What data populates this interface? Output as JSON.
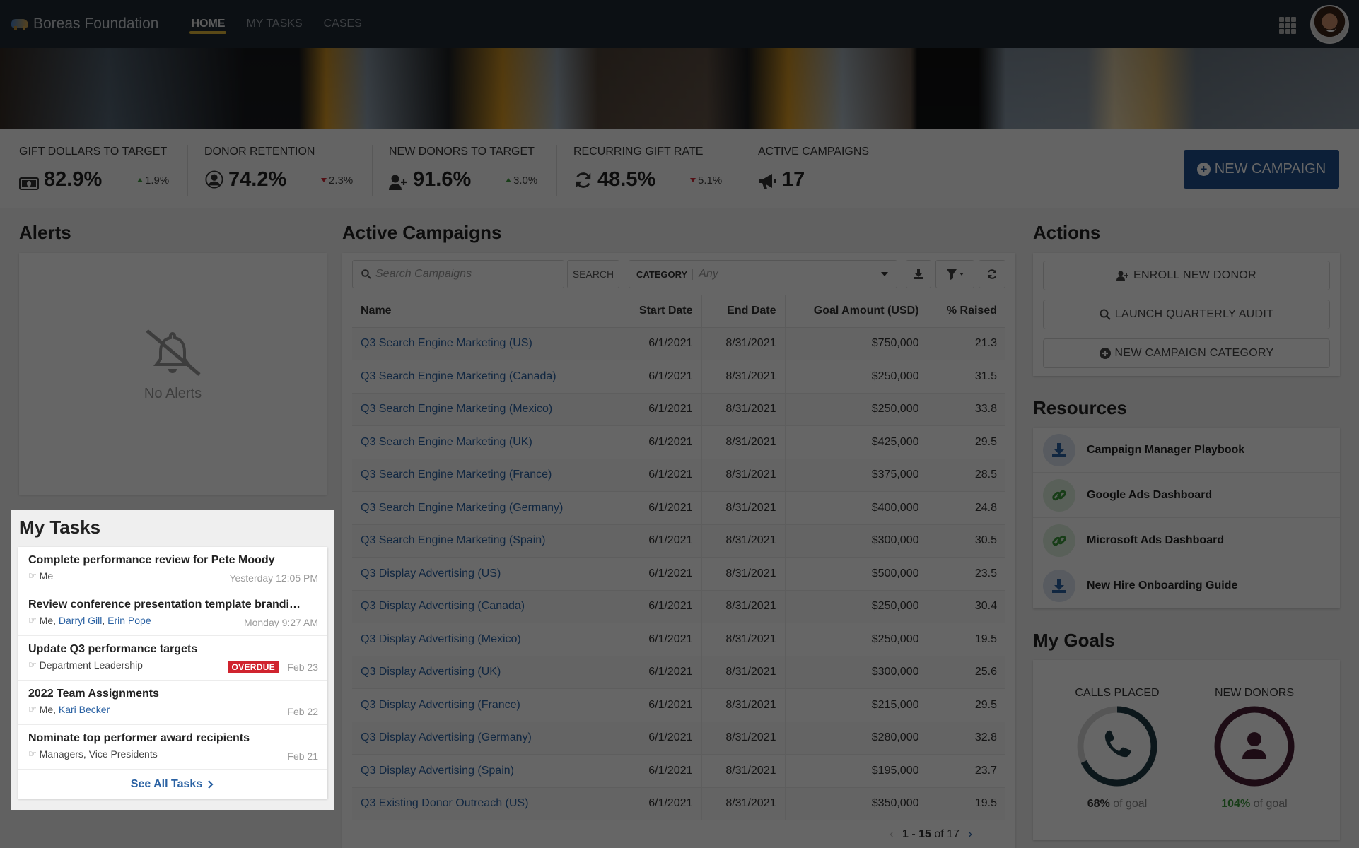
{
  "nav": {
    "brand": "Boreas Foundation",
    "tabs": [
      {
        "label": "HOME",
        "active": true
      },
      {
        "label": "MY TASKS",
        "active": false
      },
      {
        "label": "CASES",
        "active": false
      }
    ],
    "apps_icon": "grid-icon",
    "avatar": "user-avatar"
  },
  "kpis": [
    {
      "label": "GIFT DOLLARS TO TARGET",
      "icon": "money-icon",
      "value": "82.9%",
      "delta": "1.9%",
      "direction": "up"
    },
    {
      "label": "DONOR RETENTION",
      "icon": "user-circle-icon",
      "value": "74.2%",
      "delta": "2.3%",
      "direction": "down"
    },
    {
      "label": "NEW DONORS TO TARGET",
      "icon": "user-plus-icon",
      "value": "91.6%",
      "delta": "3.0%",
      "direction": "up"
    },
    {
      "label": "RECURRING GIFT RATE",
      "icon": "refresh-icon",
      "value": "48.5%",
      "delta": "5.1%",
      "direction": "down"
    },
    {
      "label": "ACTIVE CAMPAIGNS",
      "icon": "megaphone-icon",
      "value": "17"
    }
  ],
  "new_campaign_button": "NEW CAMPAIGN",
  "alerts": {
    "title": "Alerts",
    "empty_text": "No Alerts"
  },
  "campaigns": {
    "title": "Active Campaigns",
    "search_placeholder": "Search Campaigns",
    "search_button": "SEARCH",
    "category_label": "CATEGORY",
    "category_value": "Any",
    "columns": [
      "Name",
      "Start Date",
      "End Date",
      "Goal Amount (USD)",
      "% Raised"
    ],
    "rows": [
      [
        "Q3 Search Engine Marketing (US)",
        "6/1/2021",
        "8/31/2021",
        "$750,000",
        "21.3"
      ],
      [
        "Q3 Search Engine Marketing (Canada)",
        "6/1/2021",
        "8/31/2021",
        "$250,000",
        "31.5"
      ],
      [
        "Q3 Search Engine Marketing (Mexico)",
        "6/1/2021",
        "8/31/2021",
        "$250,000",
        "33.8"
      ],
      [
        "Q3 Search Engine Marketing (UK)",
        "6/1/2021",
        "8/31/2021",
        "$425,000",
        "29.5"
      ],
      [
        "Q3 Search Engine Marketing (France)",
        "6/1/2021",
        "8/31/2021",
        "$375,000",
        "28.5"
      ],
      [
        "Q3 Search Engine Marketing (Germany)",
        "6/1/2021",
        "8/31/2021",
        "$400,000",
        "24.8"
      ],
      [
        "Q3 Search Engine Marketing (Spain)",
        "6/1/2021",
        "8/31/2021",
        "$300,000",
        "30.5"
      ],
      [
        "Q3 Display Advertising (US)",
        "6/1/2021",
        "8/31/2021",
        "$500,000",
        "23.5"
      ],
      [
        "Q3 Display Advertising (Canada)",
        "6/1/2021",
        "8/31/2021",
        "$250,000",
        "30.4"
      ],
      [
        "Q3 Display Advertising (Mexico)",
        "6/1/2021",
        "8/31/2021",
        "$250,000",
        "19.5"
      ],
      [
        "Q3 Display Advertising (UK)",
        "6/1/2021",
        "8/31/2021",
        "$300,000",
        "25.6"
      ],
      [
        "Q3 Display Advertising (France)",
        "6/1/2021",
        "8/31/2021",
        "$215,000",
        "29.5"
      ],
      [
        "Q3 Display Advertising (Germany)",
        "6/1/2021",
        "8/31/2021",
        "$280,000",
        "32.8"
      ],
      [
        "Q3 Display Advertising (Spain)",
        "6/1/2021",
        "8/31/2021",
        "$195,000",
        "23.7"
      ],
      [
        "Q3 Existing Donor Outreach (US)",
        "6/1/2021",
        "8/31/2021",
        "$350,000",
        "19.5"
      ]
    ],
    "pager": {
      "range": "1 - 15",
      "of_text": "of 17"
    }
  },
  "actions": {
    "title": "Actions",
    "buttons": [
      {
        "label": "ENROLL NEW DONOR",
        "icon": "user-plus-icon"
      },
      {
        "label": "LAUNCH QUARTERLY AUDIT",
        "icon": "search-icon"
      },
      {
        "label": "NEW CAMPAIGN CATEGORY",
        "icon": "plus-circle-icon"
      }
    ]
  },
  "resources": {
    "title": "Resources",
    "items": [
      {
        "label": "Campaign Manager Playbook",
        "icon": "download-icon"
      },
      {
        "label": "Google Ads Dashboard",
        "icon": "link-icon"
      },
      {
        "label": "Microsoft Ads Dashboard",
        "icon": "link-icon"
      },
      {
        "label": "New Hire Onboarding Guide",
        "icon": "download-icon"
      }
    ]
  },
  "goals": {
    "title": "My Goals",
    "items": [
      {
        "label": "CALLS PLACED",
        "percent": "68%",
        "suffix": "of goal",
        "progress": 0.68,
        "color": "#1f3a45",
        "icon": "phone-icon"
      },
      {
        "label": "NEW DONORS",
        "percent": "104%",
        "suffix": "of goal",
        "progress": 1.0,
        "color": "#4a1f35",
        "icon": "user-icon"
      }
    ]
  },
  "tasks": {
    "title": "My Tasks",
    "items": [
      {
        "title": "Complete performance review for Pete Moody",
        "assignees": [
          {
            "name": "Me",
            "link": false
          }
        ],
        "date": "Yesterday 12:05 PM"
      },
      {
        "title": "Review conference presentation template brandi…",
        "assignees": [
          {
            "name": "Me",
            "link": false
          },
          {
            "name": "Darryl Gill",
            "link": true
          },
          {
            "name": "Erin Pope",
            "link": true
          }
        ],
        "date": "Monday 9:27 AM"
      },
      {
        "title": "Update Q3 performance targets",
        "assignees": [
          {
            "name": "Department Leadership",
            "link": false
          }
        ],
        "date": "Feb 23",
        "badge": "OVERDUE"
      },
      {
        "title": "2022 Team Assignments",
        "assignees": [
          {
            "name": "Me",
            "link": false
          },
          {
            "name": "Kari Becker",
            "link": true
          }
        ],
        "date": "Feb 22"
      },
      {
        "title": "Nominate top performer award recipients",
        "assignees": [
          {
            "name": "Managers, Vice Presidents",
            "link": false
          }
        ],
        "date": "Feb 21"
      }
    ],
    "see_all": "See All Tasks"
  }
}
